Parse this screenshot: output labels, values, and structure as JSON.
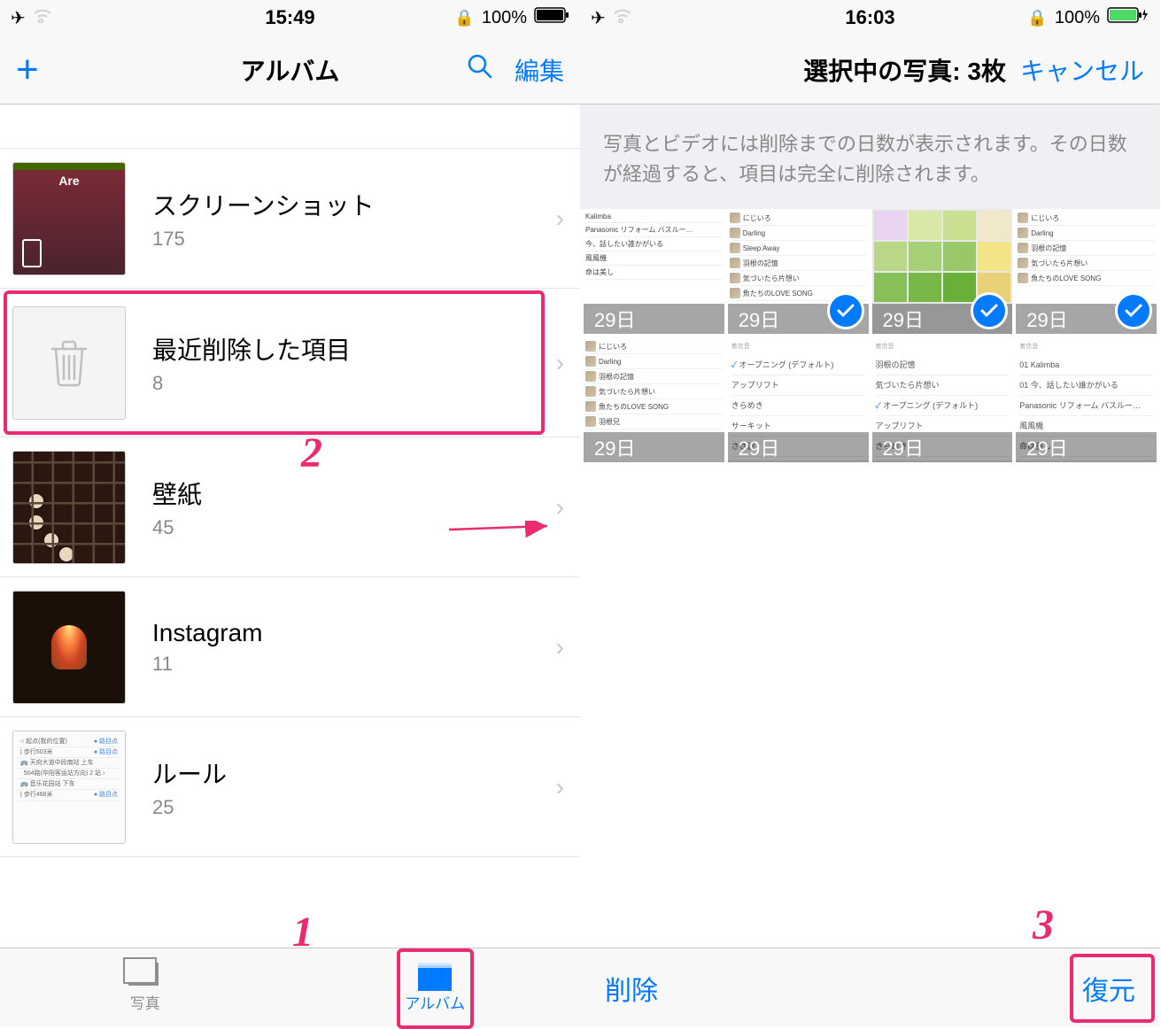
{
  "left": {
    "status": {
      "time": "15:49",
      "battery": "100%"
    },
    "nav": {
      "title": "アルバム",
      "edit": "編集"
    },
    "albums": [
      {
        "name": "スクリーンショット",
        "count": "175"
      },
      {
        "name": "最近削除した項目",
        "count": "8"
      },
      {
        "name": "壁紙",
        "count": "45"
      },
      {
        "name": "Instagram",
        "count": "11"
      },
      {
        "name": "ルール",
        "count": "25"
      }
    ],
    "tabs": {
      "photos": "写真",
      "albums": "アルバム"
    }
  },
  "right": {
    "status": {
      "time": "16:03",
      "battery": "100%"
    },
    "nav": {
      "title": "選択中の写真: 3枚",
      "cancel": "キャンセル"
    },
    "info": "写真とビデオには削除までの日数が表示されます。その日数が経過すると、項目は完全に削除されます。",
    "days": "29日",
    "grid_items": [
      {
        "selected": false
      },
      {
        "selected": true
      },
      {
        "selected": true
      },
      {
        "selected": true
      },
      {
        "selected": false
      },
      {
        "selected": false
      },
      {
        "selected": false
      },
      {
        "selected": false
      }
    ],
    "mini_tracks_a": [
      "Kalimba",
      "Panasonic リフォーム バスルー…",
      "今、話したい誰かがいる",
      "風風機",
      "命は美し"
    ],
    "mini_tracks_b": [
      "にじいろ",
      "Darling",
      "Sleep Away",
      "羽根の記憶",
      "気づいたら片想い",
      "魚たちのLOVE SONG"
    ],
    "mini_tracks_c": [
      "にじいろ",
      "Darling",
      "羽根の記憶",
      "気づいたら片想い",
      "魚たちのLOVE SONG"
    ],
    "mini_tracks_d": [
      "にじいろ",
      "Darling",
      "羽根の記憶",
      "気づいたら片想い",
      "魚たちのLOVE SONG",
      "羽根兄"
    ],
    "mini_list_e": [
      "オープニング (デフォルト)",
      "アップリフト",
      "きらめき",
      "サーキット",
      "さざ波"
    ],
    "mini_list_f": [
      "羽根の記憶",
      "気づいたら片想い",
      "オープニング (デフォルト)",
      "アップリフト",
      "きらめき"
    ],
    "mini_list_g": [
      "01 Kalimba",
      "01 今、話したい誰かがいる",
      "Panasonic リフォーム バスルー…",
      "風風機",
      "命は美し"
    ],
    "toolbar": {
      "delete": "削除",
      "recover": "復元"
    }
  },
  "annotations": {
    "n1": "1",
    "n2": "2",
    "n3": "3"
  }
}
